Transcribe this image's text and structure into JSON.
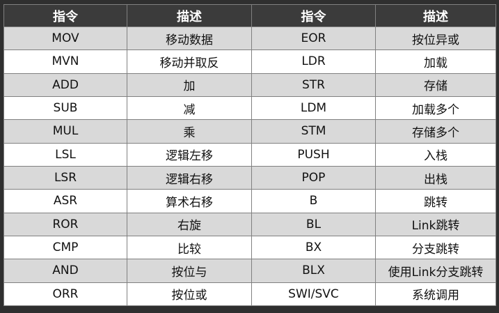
{
  "table": {
    "headers": [
      "指令",
      "描述",
      "指令",
      "描述"
    ],
    "rows": [
      [
        "MOV",
        "移动数据",
        "EOR",
        "按位异或"
      ],
      [
        "MVN",
        "移动并取反",
        "LDR",
        "加载"
      ],
      [
        "ADD",
        "加",
        "STR",
        "存储"
      ],
      [
        "SUB",
        "减",
        "LDM",
        "加载多个"
      ],
      [
        "MUL",
        "乘",
        "STM",
        "存储多个"
      ],
      [
        "LSL",
        "逻辑左移",
        "PUSH",
        "入栈"
      ],
      [
        "LSR",
        "逻辑右移",
        "POP",
        "出栈"
      ],
      [
        "ASR",
        "算术右移",
        "B",
        "跳转"
      ],
      [
        "ROR",
        "右旋",
        "BL",
        "Link跳转"
      ],
      [
        "CMP",
        "比较",
        "BX",
        "分支跳转"
      ],
      [
        "AND",
        "按位与",
        "BLX",
        "使用Link分支跳转"
      ],
      [
        "ORR",
        "按位或",
        "SWI/SVC",
        "系统调用"
      ]
    ]
  }
}
